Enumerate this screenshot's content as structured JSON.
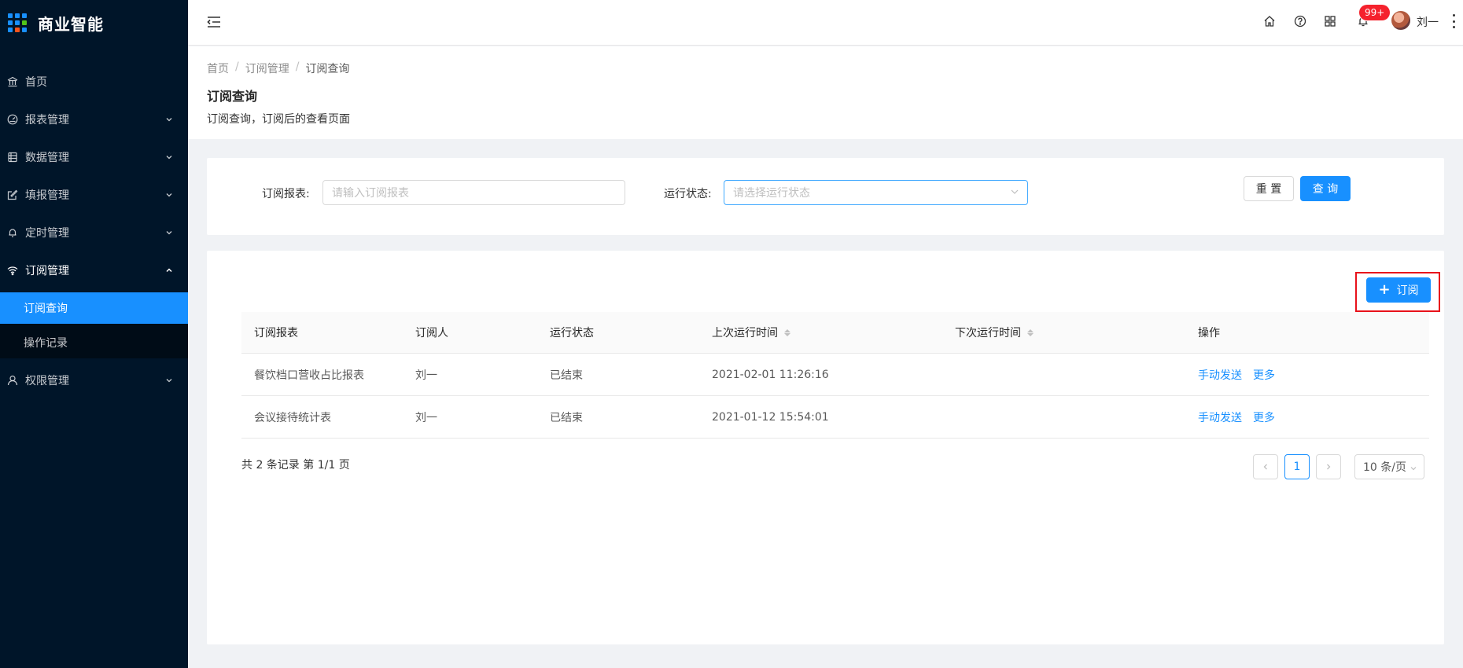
{
  "app": {
    "title": "商业智能"
  },
  "sidebar": {
    "items": [
      {
        "label": "首页",
        "icon": "bank-icon"
      },
      {
        "label": "报表管理",
        "icon": "dashboard-icon"
      },
      {
        "label": "数据管理",
        "icon": "table-icon"
      },
      {
        "label": "填报管理",
        "icon": "form-icon"
      },
      {
        "label": "定时管理",
        "icon": "bell-icon"
      },
      {
        "label": "订阅管理",
        "icon": "wifi-icon"
      },
      {
        "label": "权限管理",
        "icon": "user-icon"
      }
    ],
    "submenu": [
      {
        "label": "订阅查询",
        "active": true
      },
      {
        "label": "操作记录",
        "active": false
      }
    ]
  },
  "header": {
    "badge": "99+",
    "user": "刘一",
    "icons": [
      "home-icon",
      "help-icon",
      "apps-icon",
      "bell-icon"
    ]
  },
  "breadcrumb": [
    "首页",
    "订阅管理",
    "订阅查询"
  ],
  "page": {
    "title": "订阅查询",
    "description": "订阅查询，订阅后的查看页面"
  },
  "search": {
    "report_label": "订阅报表:",
    "report_placeholder": "请输入订阅报表",
    "status_label": "运行状态:",
    "status_placeholder": "请选择运行状态",
    "reset": "重 置",
    "query": "查 询"
  },
  "toolbar": {
    "add": "订阅"
  },
  "table": {
    "columns": [
      "订阅报表",
      "订阅人",
      "运行状态",
      "上次运行时间",
      "下次运行时间",
      "操作"
    ],
    "rows": [
      {
        "report": "餐饮档口营收占比报表",
        "user": "刘一",
        "status": "已结束",
        "last_run": "2021-02-01 11:26:16",
        "next_run": "",
        "actions": [
          "手动发送",
          "更多"
        ]
      },
      {
        "report": "会议接待统计表",
        "user": "刘一",
        "status": "已结束",
        "last_run": "2021-01-12 15:54:01",
        "next_run": "",
        "actions": [
          "手动发送",
          "更多"
        ]
      }
    ]
  },
  "pagination": {
    "summary": "共 2 条记录 第 1/1 页",
    "current": "1",
    "page_size": "10 条/页"
  },
  "colors": {
    "sidebar_bg": "#001529",
    "primary": "#1890ff",
    "badge": "#f5222d",
    "highlight": "#e8121b"
  }
}
